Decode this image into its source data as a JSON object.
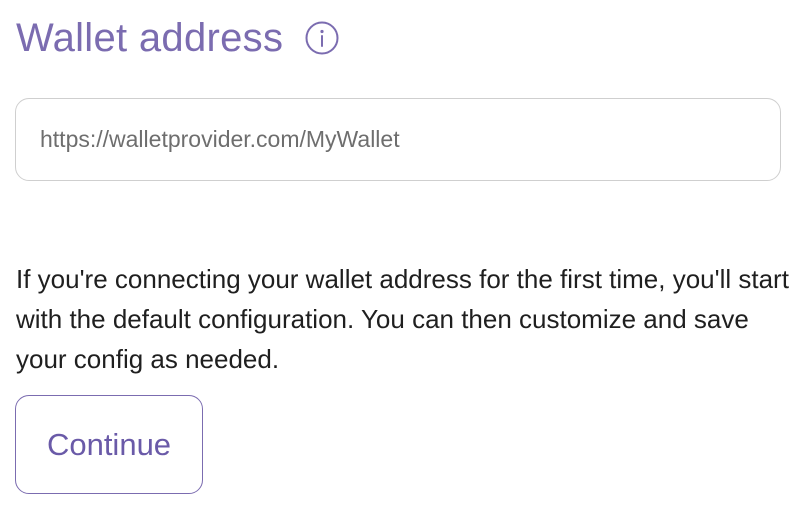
{
  "header": {
    "title": "Wallet address",
    "info_icon": "info-icon"
  },
  "wallet_input": {
    "placeholder": "https://walletprovider.com/MyWallet",
    "value": ""
  },
  "description": "If you're connecting your wallet address for the first time, you'll start with the default configuration. You can then customize and save your config as needed.",
  "continue_button": {
    "label": "Continue"
  },
  "colors": {
    "accent": "#7b6cb0",
    "input_border": "#cfcfcf",
    "text": "#1f1f1f"
  }
}
